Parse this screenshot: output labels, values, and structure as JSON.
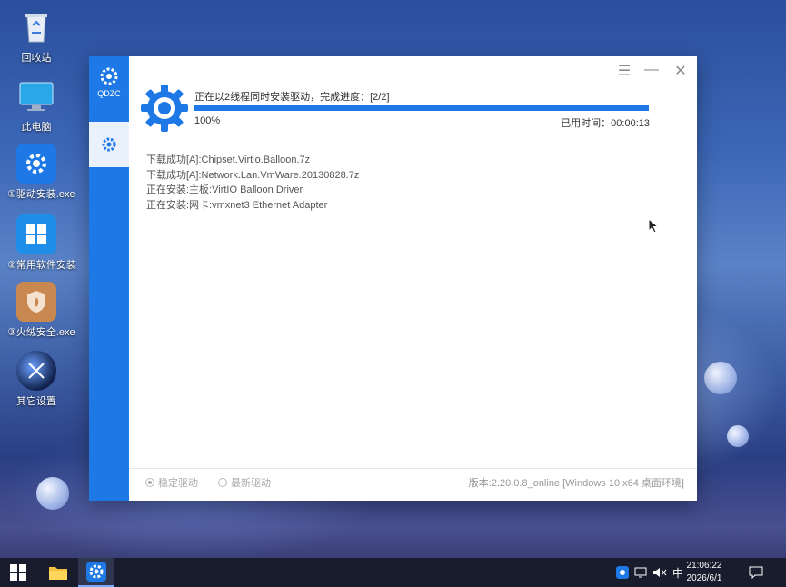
{
  "desktop": {
    "icons": [
      {
        "label": "回收站",
        "icon": "recycle-bin-icon"
      },
      {
        "label": "此电脑",
        "icon": "computer-icon"
      },
      {
        "label": "①驱动安装.exe",
        "icon": "driver-install-icon"
      },
      {
        "label": "②常用软件安装",
        "icon": "software-install-icon"
      },
      {
        "label": "③火绒安全.exe",
        "icon": "huorong-security-icon"
      },
      {
        "label": "其它设置",
        "icon": "other-settings-icon"
      }
    ]
  },
  "window": {
    "logo_text": "QDZC",
    "status_text": "正在以2线程同时安装驱动，完成进度：[2/2]",
    "progress_percent_label": "100%",
    "progress_fraction": 1.0,
    "elapsed_label": "已用时间：",
    "elapsed_time": "00:00:13",
    "log_lines": [
      "下载成功[A]:Chipset.Virtio.Balloon.7z",
      "下载成功[A]:Network.Lan.VmWare.20130828.7z",
      "正在安装:主板:VirtIO Balloon Driver",
      "正在安装:网卡:vmxnet3 Ethernet Adapter"
    ],
    "options": {
      "stable_label": "稳定驱动",
      "latest_label": "最新驱动"
    },
    "version_text": "版本:2.20.0.8_online [Windows 10 x64 桌面环境]",
    "accent_color": "#1e78e6"
  },
  "taskbar": {
    "ime_label": "中",
    "time": "21:06:22",
    "date": "2026/6/1"
  }
}
